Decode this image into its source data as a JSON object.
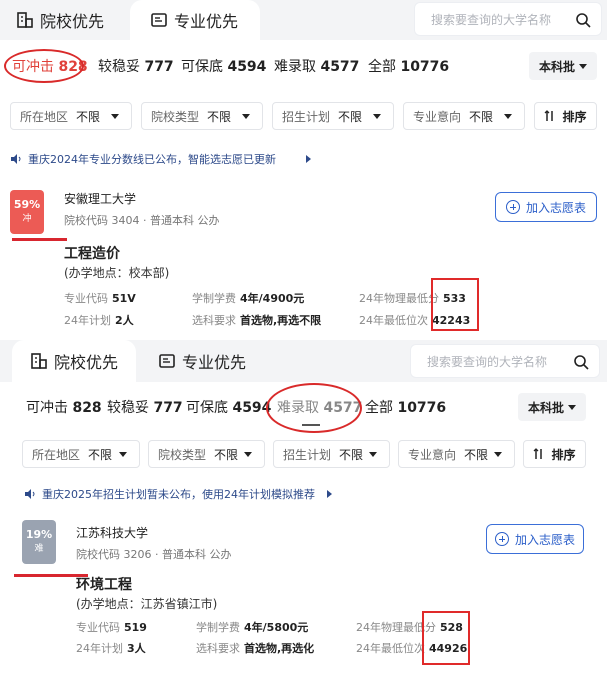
{
  "panel1": {
    "tabs": [
      {
        "label": "院校优先"
      },
      {
        "label": "专业优先"
      }
    ],
    "search_placeholder": "搜索要查询的大学名称",
    "counts": [
      {
        "label": "可冲击",
        "value": "828"
      },
      {
        "label": "较稳妥",
        "value": "777"
      },
      {
        "label": "可保底",
        "value": "4594"
      },
      {
        "label": "难录取",
        "value": "4577"
      },
      {
        "label": "全部",
        "value": "10776"
      }
    ],
    "batch": "本科批",
    "filters": [
      {
        "label": "所在地区",
        "value": "不限"
      },
      {
        "label": "院校类型",
        "value": "不限"
      },
      {
        "label": "招生计划",
        "value": "不限"
      },
      {
        "label": "专业意向",
        "value": "不限"
      }
    ],
    "sort_label": "排序",
    "notice": "重庆2024年专业分数线已公布，智能选志愿已更新",
    "card": {
      "badge_pct": "59%",
      "badge_tag": "冲",
      "name": "安徽理工大学",
      "meta": "院校代码 3404 · 普通本科 公办",
      "add_button": "加入志愿表",
      "major": "工程造价",
      "campus": "(办学地点：校本部)",
      "stats": {
        "code_label": "专业代码",
        "code": "51V",
        "fee_label": "学制学费",
        "fee": "4年/4900元",
        "min_score_label": "24年物理最低分",
        "min_score": "533",
        "plan_label": "24年计划",
        "plan": "2人",
        "req_label": "选科要求",
        "req": "首选物,再选不限",
        "min_rank_label": "24年最低位次",
        "min_rank": "42243"
      }
    }
  },
  "panel2": {
    "tabs": [
      {
        "label": "院校优先"
      },
      {
        "label": "专业优先"
      }
    ],
    "search_placeholder": "搜索要查询的大学名称",
    "counts": [
      {
        "label": "可冲击",
        "value": "828"
      },
      {
        "label": "较稳妥",
        "value": "777"
      },
      {
        "label": "可保底",
        "value": "4594"
      },
      {
        "label": "难录取",
        "value": "4577"
      },
      {
        "label": "全部",
        "value": "10776"
      }
    ],
    "batch": "本科批",
    "filters": [
      {
        "label": "所在地区",
        "value": "不限"
      },
      {
        "label": "院校类型",
        "value": "不限"
      },
      {
        "label": "招生计划",
        "value": "不限"
      },
      {
        "label": "专业意向",
        "value": "不限"
      }
    ],
    "sort_label": "排序",
    "notice": "重庆2025年招生计划暂未公布，使用24年计划模拟推荐",
    "card": {
      "badge_pct": "19%",
      "badge_tag": "难",
      "name": "江苏科技大学",
      "meta": "院校代码 3206 · 普通本科 公办",
      "add_button": "加入志愿表",
      "major": "环境工程",
      "campus": "(办学地点：江苏省镇江市)",
      "stats": {
        "code_label": "专业代码",
        "code": "519",
        "fee_label": "学制学费",
        "fee": "4年/5800元",
        "min_score_label": "24年物理最低分",
        "min_score": "528",
        "plan_label": "24年计划",
        "plan": "3人",
        "req_label": "选科要求",
        "req": "首选物,再选化",
        "min_rank_label": "24年最低位次",
        "min_rank": "44926"
      }
    }
  },
  "colors": {
    "accent": "#2c5fc9",
    "rush": "#ec5b55",
    "hard": "#9aa3b1",
    "annotation": "#e02a2a"
  }
}
